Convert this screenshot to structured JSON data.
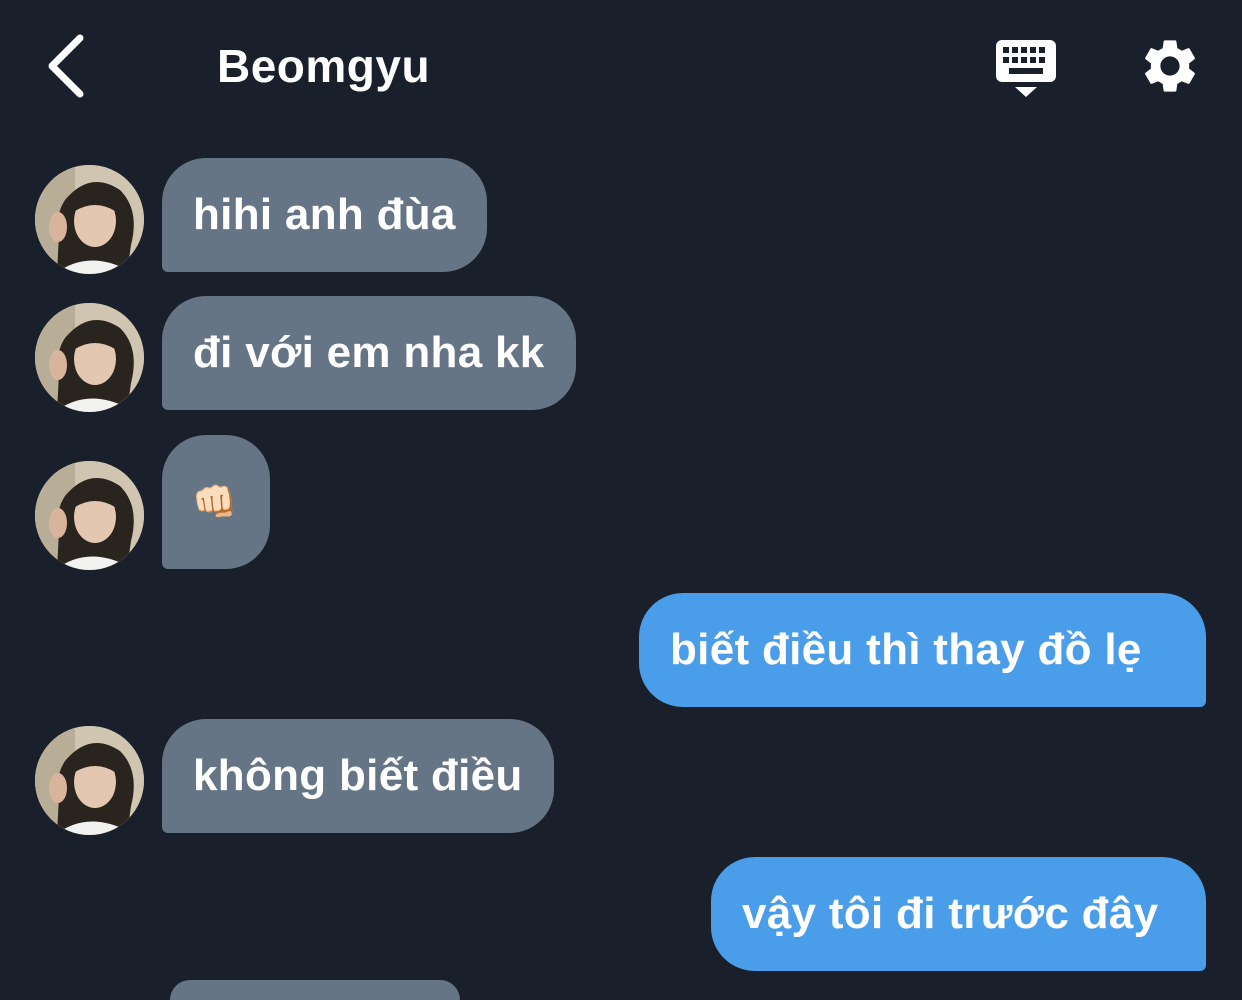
{
  "header": {
    "title": "Beomgyu",
    "back_icon": "chevron-left-icon",
    "keyboard_icon": "keyboard-icon",
    "settings_icon": "gear-icon"
  },
  "messages": [
    {
      "from": "contact",
      "text": "hihi anh đùa"
    },
    {
      "from": "contact",
      "text": "đi với em nha kk"
    },
    {
      "from": "contact",
      "text": "👊🏻"
    },
    {
      "from": "me",
      "text": "biết điều thì thay đồ lẹ"
    },
    {
      "from": "contact",
      "text": "không biết điều"
    },
    {
      "from": "me",
      "text": "vậy tôi đi trước đây"
    }
  ],
  "colors": {
    "background": "#1a202b",
    "received_bubble": "#667585",
    "sent_bubble": "#4a9de9"
  }
}
